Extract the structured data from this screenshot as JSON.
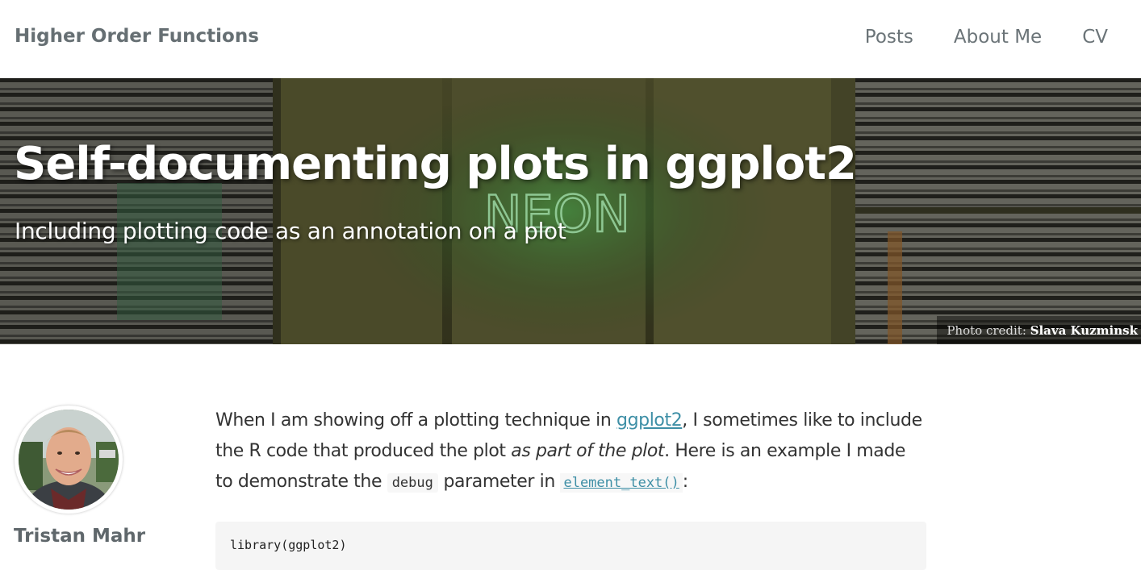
{
  "navbar": {
    "brand": "Higher Order Functions",
    "links": [
      {
        "label": "Posts"
      },
      {
        "label": "About Me"
      },
      {
        "label": "CV"
      }
    ]
  },
  "hero": {
    "title": "Self-documenting plots in ggplot2",
    "subtitle": "Including plotting code as an annotation on a plot",
    "photo_credit_prefix": "Photo credit: ",
    "photo_credit_name": "Slava Kuzminsk",
    "neon_sign_text": "NEON"
  },
  "author": {
    "name": "Tristan Mahr"
  },
  "article": {
    "intro": {
      "part1": "When I am showing off a plotting technique in ",
      "link_ggplot2": "ggplot2",
      "part2": ", I sometimes like to include the R code that produced the plot ",
      "emphasis": "as part of the plot",
      "part3": ". Here is an example I made to demonstrate the ",
      "code_debug": "debug",
      "part4": " parameter in ",
      "code_element_text": "element_text()",
      "part5": ":"
    },
    "code_block_first_line": "library(ggplot2)"
  },
  "colors": {
    "link": "#3e8fa6",
    "brand_text": "#666f73",
    "neon_glow": "#2ed84a"
  }
}
